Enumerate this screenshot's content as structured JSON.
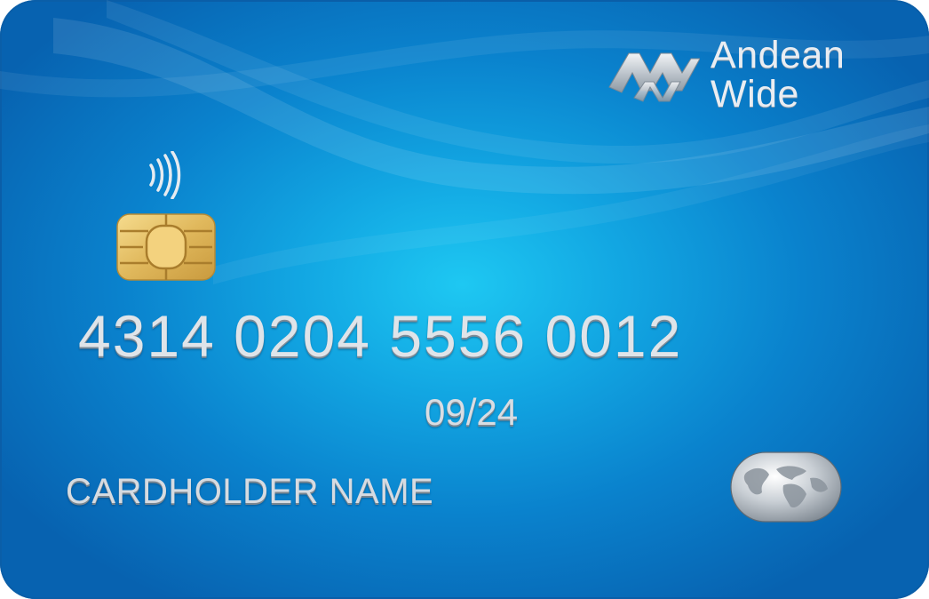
{
  "brand": {
    "line1": "Andean",
    "line2": "Wide"
  },
  "card": {
    "number": "4314 0204 5556 0012",
    "expiry": "09/24",
    "holder": "CARDHOLDER NAME"
  },
  "icons": {
    "brand_logo": "andean-wide-logo",
    "contactless": "contactless-icon",
    "chip": "emv-chip",
    "network": "globe-hologram"
  },
  "colors": {
    "card_center": "#1ec8f2",
    "card_edge": "#0762b0",
    "embossed_text": "#dfe4e9",
    "chip_gold": "#e8c46a"
  }
}
